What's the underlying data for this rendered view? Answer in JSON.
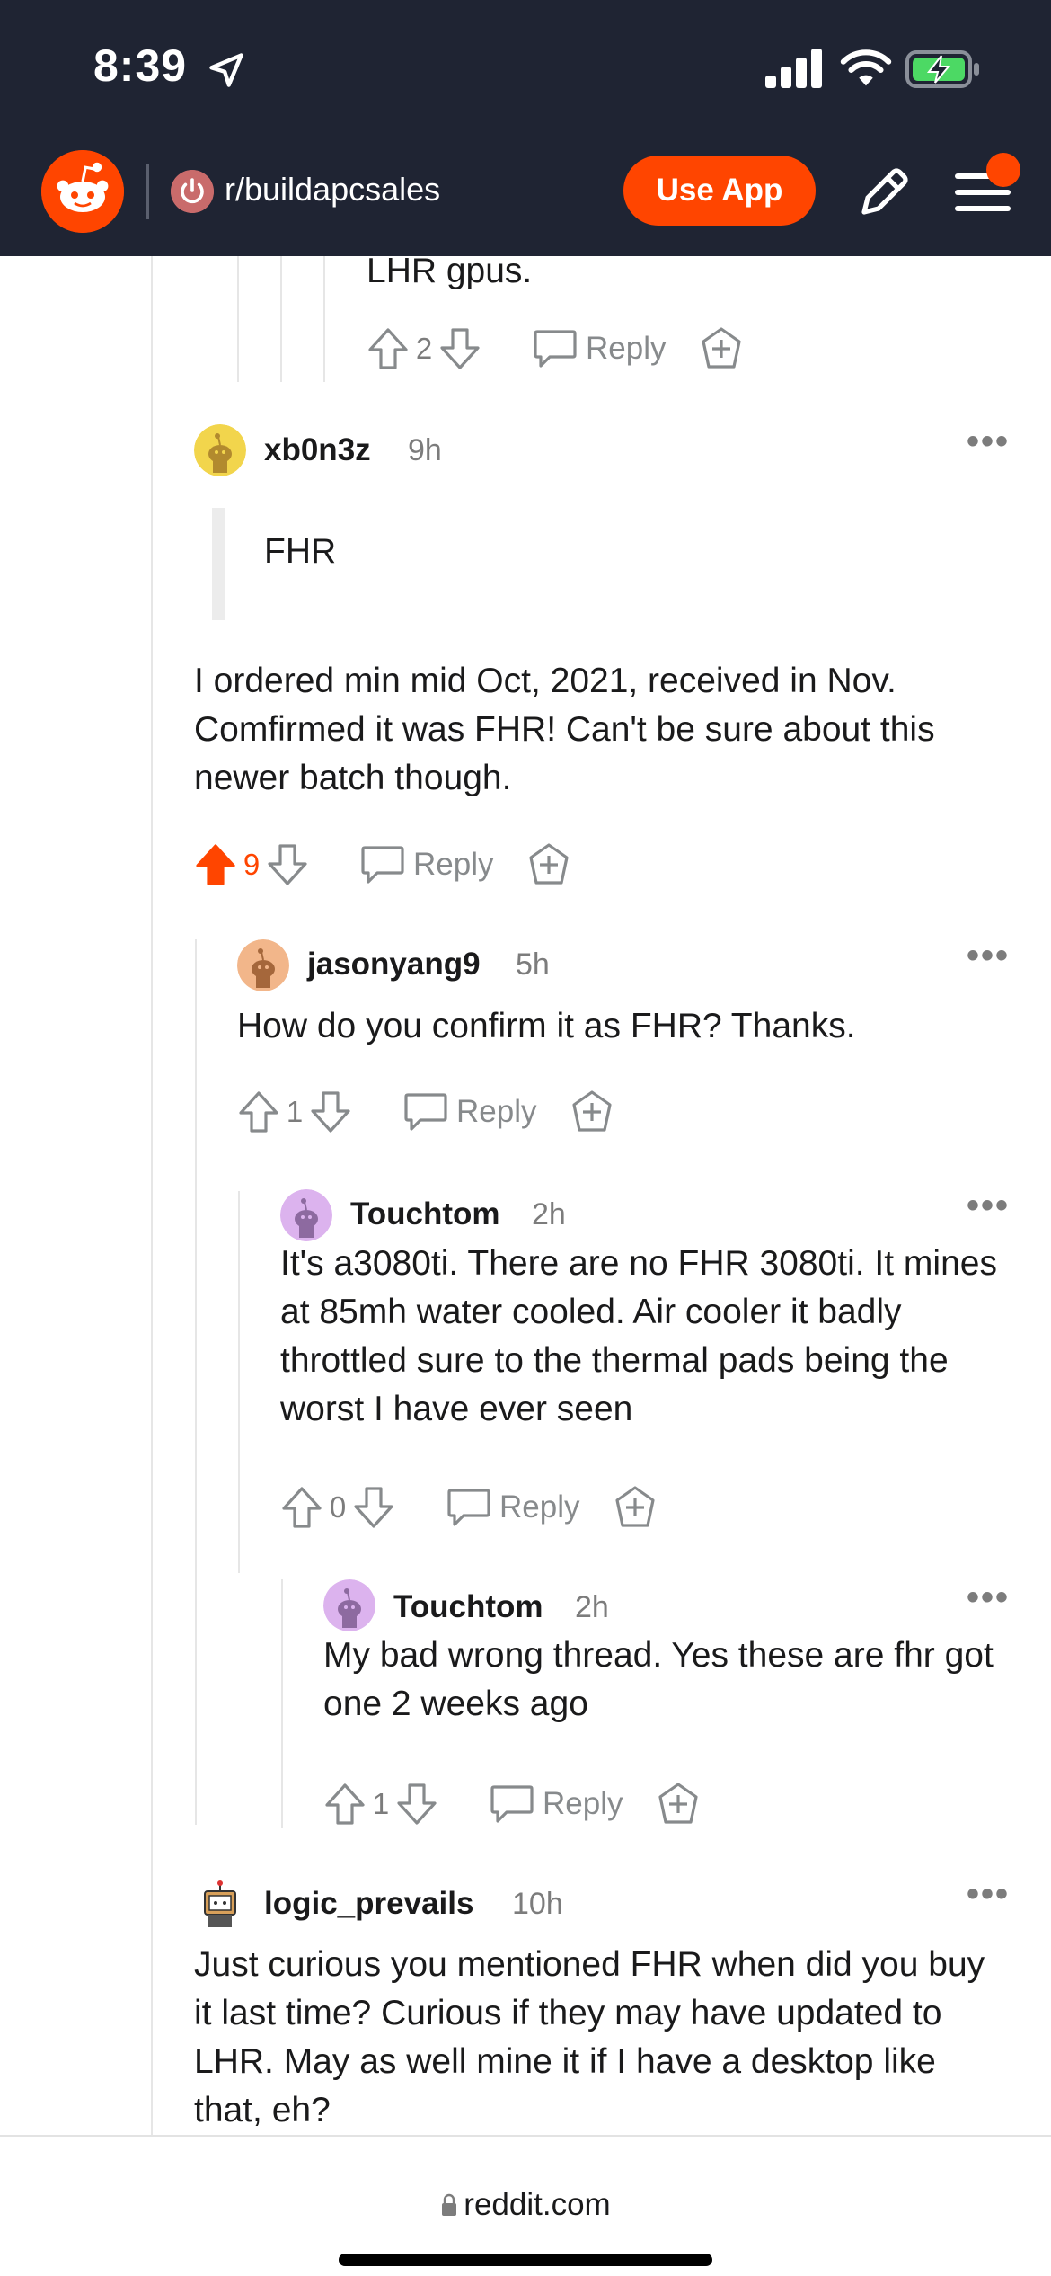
{
  "status_bar": {
    "time": "8:39"
  },
  "header": {
    "subreddit": "r/buildapcsales",
    "use_app_label": "Use App",
    "brand_color": "#ff4500"
  },
  "previous_comment": {
    "tail_text": "LHR gpus.",
    "score": "2",
    "reply_label": "Reply"
  },
  "comments": [
    {
      "username": "xb0n3z",
      "time": "9h",
      "quote": "FHR",
      "body": "I ordered min mid Oct, 2021, received in Nov. Comfirmed it was FHR! Can't be sure about this newer batch though.",
      "score": "9",
      "upvoted": true,
      "reply_label": "Reply",
      "more": "•••"
    },
    {
      "username": "jasonyang9",
      "time": "5h",
      "body": "How do you confirm it as FHR? Thanks.",
      "score": "1",
      "reply_label": "Reply",
      "more": "•••"
    },
    {
      "username": "Touchtom",
      "time": "2h",
      "body": "It's a3080ti. There are no FHR 3080ti. It mines at 85mh water cooled. Air cooler it badly throttled sure to the thermal pads being the worst I have ever seen",
      "score": "0",
      "reply_label": "Reply",
      "more": "•••"
    },
    {
      "username": "Touchtom",
      "time": "2h",
      "body": "My bad wrong thread. Yes these are fhr got one 2 weeks ago",
      "score": "1",
      "reply_label": "Reply",
      "more": "•••"
    },
    {
      "username": "logic_prevails",
      "time": "10h",
      "body": "Just curious you mentioned FHR when did you buy it last time? Curious if they may have updated to LHR. May as well mine it if I have a desktop like that, eh?",
      "more": "•••"
    }
  ],
  "browser": {
    "url": "reddit.com"
  }
}
